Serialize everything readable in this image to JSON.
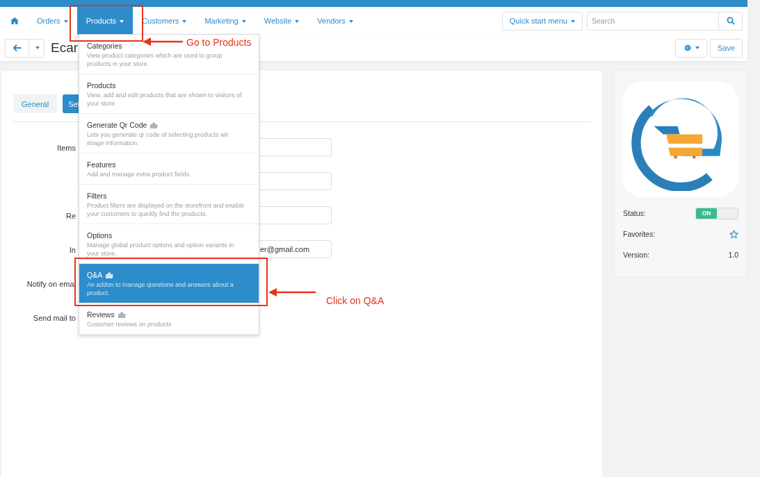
{
  "nav": {
    "items": [
      {
        "label": "Orders",
        "selected": false
      },
      {
        "label": "Products",
        "selected": true
      },
      {
        "label": "Customers",
        "selected": false
      },
      {
        "label": "Marketing",
        "selected": false
      },
      {
        "label": "Website",
        "selected": false
      },
      {
        "label": "Vendors",
        "selected": false
      }
    ],
    "quick_start": "Quick start menu",
    "search": {
      "placeholder": "Search"
    }
  },
  "header": {
    "title": "Ecar",
    "save": "Save"
  },
  "tabs": [
    {
      "label": "General",
      "selected": false
    },
    {
      "label": "Set",
      "selected": true
    }
  ],
  "form": [
    {
      "label": "Items",
      "kind": "input"
    },
    {
      "kind": "input"
    },
    {
      "label": "Re",
      "kind": "input"
    },
    {
      "label": "In",
      "kind": "input",
      "value": "er@gmail.com"
    },
    {
      "label": "Notify on emai",
      "kind": "plain"
    },
    {
      "label": "Send mail to",
      "kind": "plain"
    }
  ],
  "dropdown": [
    {
      "title": "Categories",
      "description": "View product categories which are used to group products in your store.",
      "addon": false,
      "selected": false
    },
    {
      "title": "Products",
      "description": "View, add and edit products that are shown to visitors of your store.",
      "addon": false,
      "selected": false
    },
    {
      "title": "Generate Qr Code",
      "description": "Lets you generate qr code of selecting products wit image Information.",
      "addon": true,
      "selected": false
    },
    {
      "title": "Features",
      "description": "Add and manage extra product fields.",
      "addon": false,
      "selected": false
    },
    {
      "title": "Filters",
      "description": "Product filters are displayed on the storefront and enable your customers to quickly find the products.",
      "addon": false,
      "selected": false
    },
    {
      "title": "Options",
      "description": "Manage global product options and option variants in your store.",
      "addon": false,
      "selected": false
    },
    {
      "title": "Q&A",
      "description": "An addon to manage questions and answers about a product.",
      "addon": true,
      "selected": true
    },
    {
      "title": "Reviews",
      "description": "Customer reviews on products",
      "addon": true,
      "selected": false
    }
  ],
  "sidebar": {
    "status_label": "Status:",
    "status": {
      "label": "ON",
      "on": true
    },
    "favorites_label": "Favorites:",
    "favorite": false,
    "version_label": "Version:",
    "version": "1.0"
  },
  "annotations": [
    {
      "text": "Go to Products"
    },
    {
      "text": "Click on Q&A"
    }
  ]
}
